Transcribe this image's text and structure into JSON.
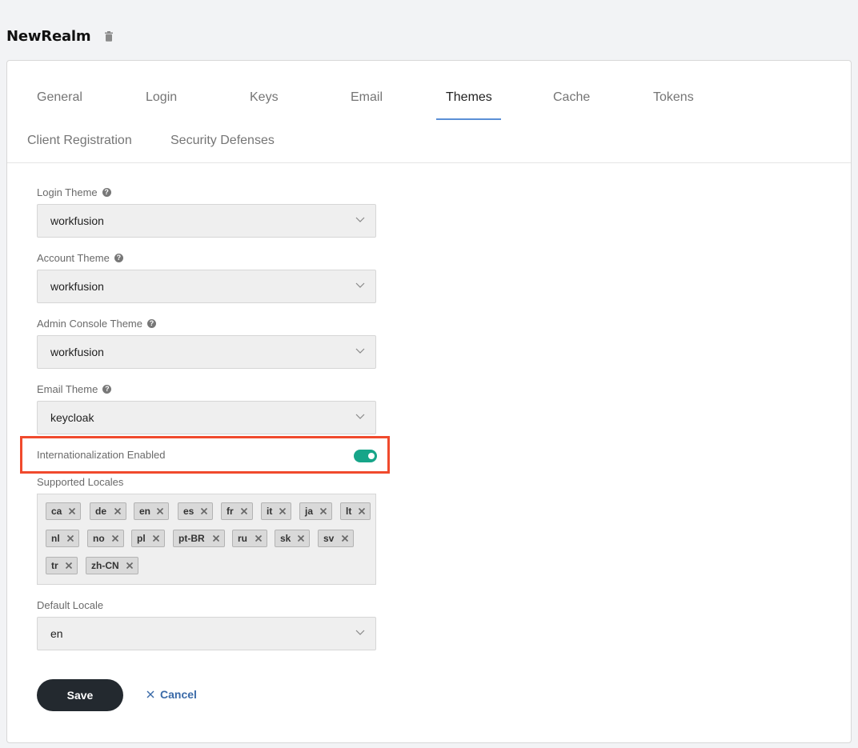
{
  "realm": {
    "name": "NewRealm",
    "delete_icon": "trash-icon"
  },
  "tabs": [
    {
      "label": "General"
    },
    {
      "label": "Login"
    },
    {
      "label": "Keys"
    },
    {
      "label": "Email"
    },
    {
      "label": "Themes",
      "active": true
    },
    {
      "label": "Cache"
    },
    {
      "label": "Tokens"
    },
    {
      "label": "Client Registration"
    },
    {
      "label": "Security Defenses"
    }
  ],
  "form": {
    "login_theme": {
      "label": "Login Theme",
      "value": "workfusion"
    },
    "account_theme": {
      "label": "Account Theme",
      "value": "workfusion"
    },
    "admin_console_theme": {
      "label": "Admin Console Theme",
      "value": "workfusion"
    },
    "email_theme": {
      "label": "Email Theme",
      "value": "keycloak"
    },
    "internationalization": {
      "label": "Internationalization Enabled",
      "enabled": true
    },
    "supported_locales": {
      "label": "Supported Locales",
      "items": [
        "ca",
        "de",
        "en",
        "es",
        "fr",
        "it",
        "ja",
        "lt",
        "nl",
        "no",
        "pl",
        "pt-BR",
        "ru",
        "sk",
        "sv",
        "tr",
        "zh-CN"
      ]
    },
    "default_locale": {
      "label": "Default Locale",
      "value": "en"
    }
  },
  "actions": {
    "save_label": "Save",
    "cancel_label": "Cancel"
  },
  "colors": {
    "accent_tab": "#5b8fd6",
    "toggle_on": "#17a589",
    "highlight": "#f04a2d",
    "save_bg": "#23292f",
    "cancel": "#3a6aa8"
  }
}
